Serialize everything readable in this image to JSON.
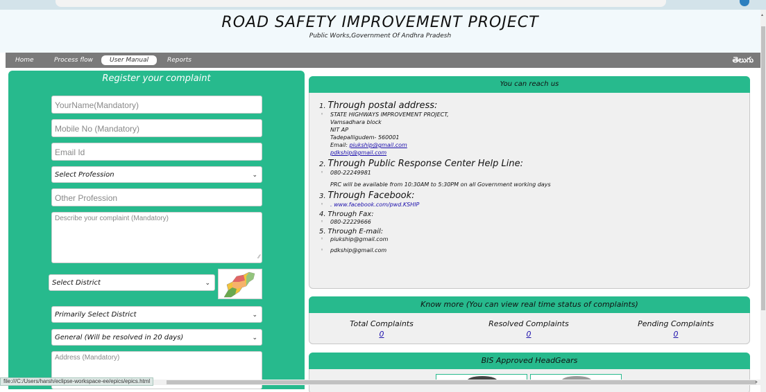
{
  "header": {
    "title": "ROAD SAFETY IMPROVEMENT PROJECT",
    "subtitle": "Public Works,Government Of Andhra Pradesh"
  },
  "nav": {
    "items": [
      "Home",
      "Process flow",
      "User Manual",
      "Reports"
    ],
    "active": "User Manual",
    "language": "తెలుగు"
  },
  "form": {
    "title": "Register your complaint",
    "name_placeholder": "YourName(Mandatory)",
    "mobile_placeholder": "Mobile No (Mandatory)",
    "email_placeholder": "Email Id",
    "profession_select": "Select Profession",
    "other_profession_placeholder": "Other Profession",
    "complaint_placeholder": "Describe your complaint (Mandatory)",
    "district_select": "Select District",
    "map_caption": "Andhra Pradesh district map",
    "primary_district_select": "Primarily Select District",
    "category_select": "General (Will be resolved in 20 days)",
    "address_placeholder": "Address (Mandatory)"
  },
  "contact": {
    "header": "You can reach us",
    "postal_heading": "Through postal address:",
    "postal_lines": [
      "STATE HIGHWAYS IMPROVEMENT PROJECT,",
      "Vamsadhara block",
      "NIT AP",
      "Tadepalligudem- 560001"
    ],
    "email_prefix": "Email:",
    "email_1": "piukship@gmail.com",
    "email_2": "pdkship@gmail.com",
    "prc_heading": "Through Public Response Center Help Line:",
    "prc_phone": "080-22249981",
    "prc_note": "PRC will be available from 10:30AM to 5:30PM on all Government working days",
    "facebook_heading": "Through Facebook:",
    "facebook_link": ". www.facebook.com/pwd.KSHIP",
    "fax_heading": "Through Fax:",
    "fax_number": "080-22229666",
    "email_heading": "Through E-mail:",
    "email_list": [
      "piukship@gmail.com",
      "pdkship@gmail.com"
    ]
  },
  "stats": {
    "header": "Know more (You can view real time status of complaints)",
    "total_label": "Total Complaints",
    "total_value": "0",
    "resolved_label": "Resolved Complaints",
    "resolved_value": "0",
    "pending_label": "Pending Complaints",
    "pending_value": "0"
  },
  "headgear": {
    "header": "BIS Approved HeadGears"
  },
  "status_bar": {
    "url": "file:///C:/Users/harsh/eclipse-workspace-ee/epics/epics.html"
  },
  "colors": {
    "accent": "#27ba8d",
    "navbar": "#7a7a7a",
    "link": "#1a0dab"
  }
}
